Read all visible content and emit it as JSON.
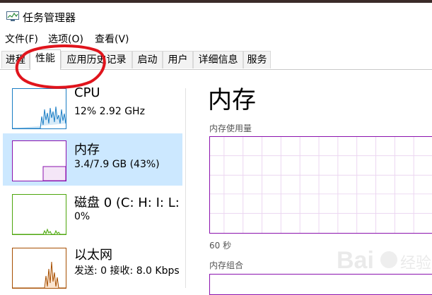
{
  "window": {
    "title": "任务管理器"
  },
  "menu": [
    "文件(F)",
    "选项(O)",
    "查看(V)"
  ],
  "tabs": [
    "进程",
    "性能",
    "应用历史记录",
    "启动",
    "用户",
    "详细信息",
    "服务"
  ],
  "active_tab": "性能",
  "resources": [
    {
      "name": "CPU",
      "detail": "12%  2.92 GHz",
      "color": "#1a7dc4"
    },
    {
      "name": "内存",
      "detail": "3.4/7.9 GB (43%)",
      "color": "#8b12ae",
      "selected": true
    },
    {
      "name": "磁盘 0 (C: H: I: L:",
      "detail": "0%",
      "color": "#4da60c"
    },
    {
      "name": "以太网",
      "detail": "发送: 0  接收: 8.0 Kbps",
      "color": "#a74f01"
    }
  ],
  "detail_panel": {
    "title": "内存",
    "usage_label": "内存使用量",
    "time_label": "60 秒",
    "composition_label": "内存组合"
  },
  "watermark": "Bai 经验",
  "annotation_color": "#e0141c"
}
